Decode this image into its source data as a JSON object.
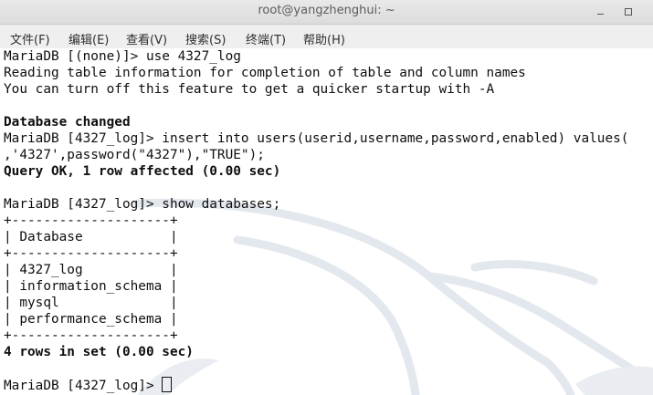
{
  "window": {
    "title": "root@yangzhenghui: ~",
    "minimize_glyph": "",
    "maximize_glyph": ""
  },
  "menu": [
    {
      "label": "文件(F)"
    },
    {
      "label": "编辑(E)"
    },
    {
      "label": "查看(V)"
    },
    {
      "label": "搜索(S)"
    },
    {
      "label": "终端(T)"
    },
    {
      "label": "帮助(H)"
    }
  ],
  "terminal": {
    "lines": [
      {
        "text": "MariaDB [(none)]> use 4327_log",
        "bold": false
      },
      {
        "text": "Reading table information for completion of table and column names",
        "bold": false
      },
      {
        "text": "You can turn off this feature to get a quicker startup with -A",
        "bold": false
      },
      {
        "text": "",
        "bold": false
      },
      {
        "text": "Database changed",
        "bold": true
      },
      {
        "text": "MariaDB [4327_log]> insert into users(userid,username,password,enabled) values(",
        "bold": false
      },
      {
        "text": ",'4327',password(\"4327\"),\"TRUE\");",
        "bold": false
      },
      {
        "text": "Query OK, 1 row affected (0.00 sec)",
        "bold": true
      },
      {
        "text": "",
        "bold": false
      },
      {
        "text": "MariaDB [4327_log]> show databases;",
        "bold": false
      },
      {
        "text": "+--------------------+",
        "bold": false
      },
      {
        "text": "| Database           |",
        "bold": false
      },
      {
        "text": "+--------------------+",
        "bold": false
      },
      {
        "text": "| 4327_log           |",
        "bold": false
      },
      {
        "text": "| information_schema |",
        "bold": false
      },
      {
        "text": "| mysql              |",
        "bold": false
      },
      {
        "text": "| performance_schema |",
        "bold": false
      },
      {
        "text": "+--------------------+",
        "bold": false
      },
      {
        "text": "4 rows in set (0.00 sec)",
        "bold": true
      },
      {
        "text": "",
        "bold": false
      }
    ],
    "prompt": "MariaDB [4327_log]> "
  }
}
